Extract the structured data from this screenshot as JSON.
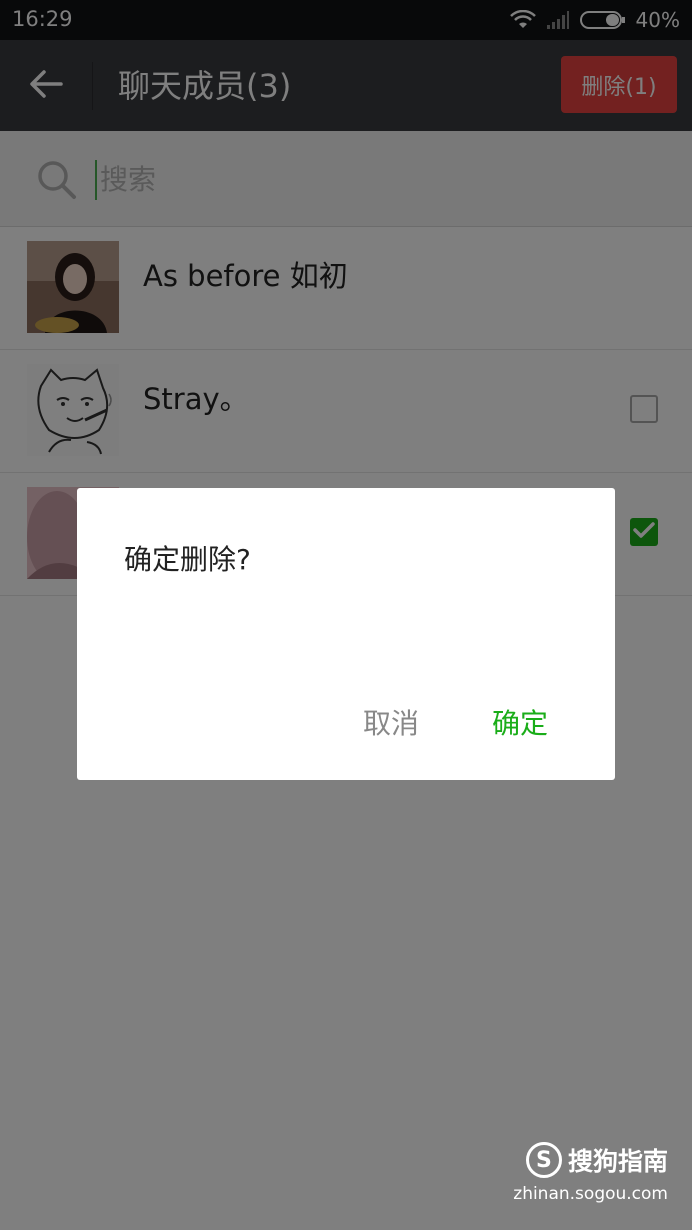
{
  "status_bar": {
    "time": "16:29",
    "battery": "40%",
    "icons": [
      "wifi-icon",
      "signal-icon",
      "battery-icon"
    ]
  },
  "app_bar": {
    "title": "聊天成员(3)",
    "delete_label": "删除(1)",
    "back_icon": "arrow-left-icon",
    "colors": {
      "bar": "#393a3f",
      "delete": "#e64340"
    }
  },
  "search": {
    "placeholder": "搜索",
    "icon": "search-icon"
  },
  "members": [
    {
      "name": "As before 如初",
      "checkbox": "none",
      "avatar": "avatar-photo-icon"
    },
    {
      "name": "Stray。",
      "checkbox": "unchecked",
      "avatar": "avatar-meme-icon"
    },
    {
      "name": "",
      "checkbox": "checked",
      "avatar": "avatar-photo-icon"
    }
  ],
  "dialog": {
    "message": "确定删除?",
    "cancel_label": "取消",
    "confirm_label": "确定",
    "confirm_color": "#1aad19"
  },
  "watermark": {
    "logo_letter": "S",
    "brand": "搜狗指南",
    "url": "zhinan.sogou.com"
  }
}
